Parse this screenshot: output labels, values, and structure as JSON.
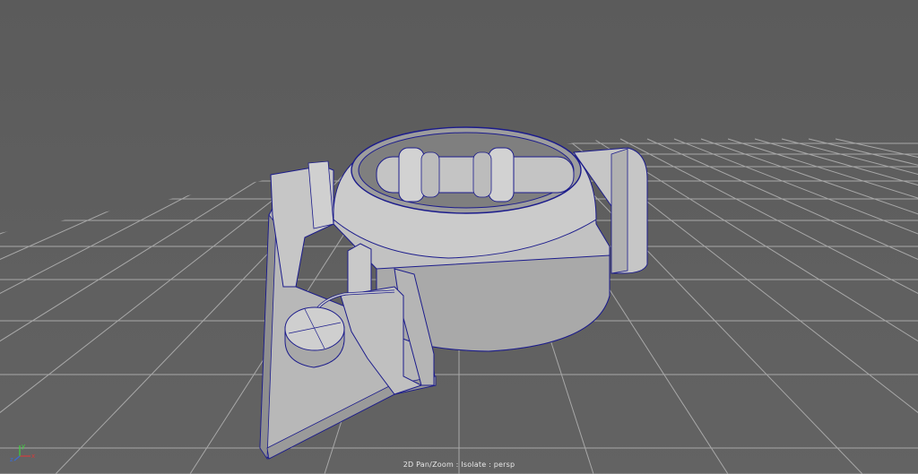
{
  "viewport": {
    "camera": "persp",
    "hud_label": "2D Pan/Zoom : Isolate : persp",
    "background_color": "#5f5f5f",
    "grid_color": "#a8a8a8",
    "wire_color": "#1c1c8c",
    "mesh_color": "#bdbdbd"
  },
  "axis_gizmo": {
    "x_label": "x",
    "y_label": "y",
    "z_label": "z",
    "x_color": "#d23c3c",
    "y_color": "#3cd23c",
    "z_color": "#3c6cd2"
  }
}
